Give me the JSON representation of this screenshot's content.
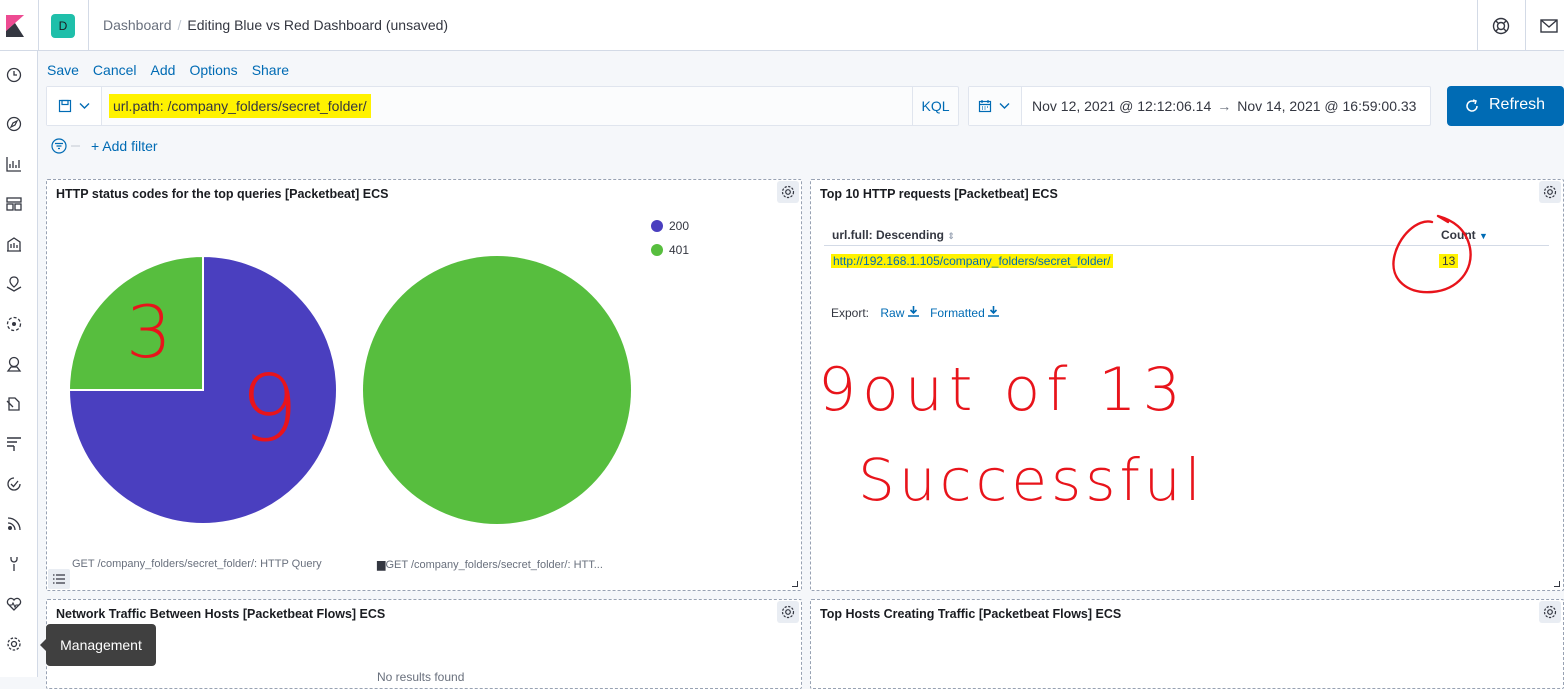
{
  "header": {
    "space_initial": "D",
    "breadcrumb_root": "Dashboard",
    "breadcrumb_current": "Editing Blue vs Red Dashboard (unsaved)"
  },
  "toolbar": {
    "save": "Save",
    "cancel": "Cancel",
    "add": "Add",
    "options": "Options",
    "share": "Share"
  },
  "query": {
    "text": "url.path: /company_folders/secret_folder/",
    "language": "KQL"
  },
  "time": {
    "start": "Nov 12, 2021 @ 12:12:06.14",
    "arrow": "→",
    "end": "Nov 14, 2021 @ 16:59:00.33",
    "refresh_label": "Refresh"
  },
  "filters": {
    "add_filter": "+ Add filter"
  },
  "panels": {
    "status_codes": {
      "title": "HTTP status codes for the top queries [Packetbeat] ECS",
      "legend": [
        {
          "label": "200",
          "color": "#4a3fbf"
        },
        {
          "label": "401",
          "color": "#57be3e"
        }
      ],
      "caption_left": "GET /company_folders/secret_folder/: HTTP Query",
      "caption_right": "GET /company_folders/secret_folder/: HTT..."
    },
    "top_requests": {
      "title": "Top 10 HTTP requests [Packetbeat] ECS",
      "col_url": "url.full: Descending",
      "col_count": "Count",
      "row_url": "http://192.168.1.105/company_folders/secret_folder/",
      "row_count": "13",
      "export_label": "Export:",
      "export_raw": "Raw",
      "export_formatted": "Formatted"
    },
    "network_traffic": {
      "title": "Network Traffic Between Hosts [Packetbeat Flows] ECS",
      "no_results": "No results found"
    },
    "top_hosts": {
      "title": "Top Hosts Creating Traffic [Packetbeat Flows] ECS"
    }
  },
  "chart_data": [
    {
      "type": "pie",
      "categories": [
        "200",
        "401"
      ],
      "values": [
        9,
        3
      ],
      "colors": [
        "#4a3fbf",
        "#57be3e"
      ],
      "legend": "top-right"
    },
    {
      "type": "pie",
      "categories": [
        "401"
      ],
      "values": [
        1
      ],
      "colors": [
        "#57be3e"
      ]
    }
  ],
  "annotations": {
    "pie_small": "3",
    "pie_large": "9",
    "note_line1": "9out of 13",
    "note_line2": "Successful"
  },
  "tooltip": {
    "text": "Management"
  },
  "colors": {
    "accent": "#006bb4",
    "highlight": "#fff200",
    "annotation": "#e8141b"
  }
}
